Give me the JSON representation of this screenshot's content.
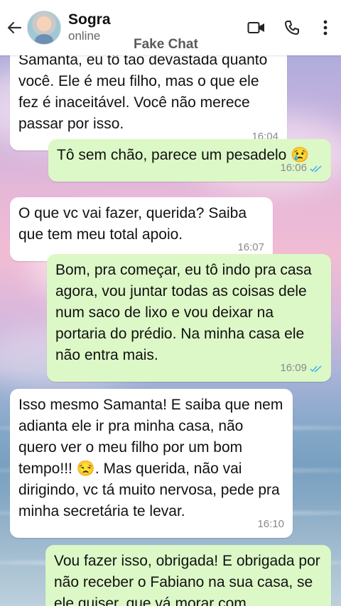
{
  "header": {
    "contact_name": "Sogra",
    "status": "online",
    "watermark": "Fake Chat",
    "icons": [
      "back-arrow-icon",
      "video-call-icon",
      "phone-call-icon",
      "more-vertical-icon"
    ]
  },
  "messages": [
    {
      "side": "in",
      "text": "Samanta, eu tô tão devastada quanto você. Ele é meu filho, mas o que ele fez é inaceitável. Você não merece passar por isso.",
      "time": "16:04"
    },
    {
      "side": "out",
      "text": "Tô sem chão, parece um pesadelo 😢",
      "time": "16:06",
      "read": true
    },
    {
      "side": "in",
      "text": "O que vc vai fazer, querida? Saiba que tem meu total apoio.",
      "time": "16:07"
    },
    {
      "side": "out",
      "text": "Bom, pra começar, eu tô indo pra casa agora, vou juntar todas as coisas dele num saco de lixo e vou deixar na portaria do prédio. Na minha casa ele não entra mais.",
      "time": "16:09",
      "read": true
    },
    {
      "side": "in",
      "text": "Isso mesmo Samanta! E saiba que nem adianta ele ir pra minha casa, não quero ver o meu filho por um bom tempo!!! 😒. Mas querida, não vai dirigindo, vc tá muito nervosa, pede pra minha secretária te levar.",
      "time": "16:10"
    },
    {
      "side": "out",
      "text": "Vou fazer isso, obrigada! E obrigada por  não receber o Fabiano na sua casa, se ele quiser, que vá morar com",
      "time": ""
    }
  ],
  "colors": {
    "incoming_bubble": "#ffffff",
    "outgoing_bubble": "#dcf8c6",
    "read_ticks": "#4fb6ec",
    "header_bg": "#ffffff"
  }
}
